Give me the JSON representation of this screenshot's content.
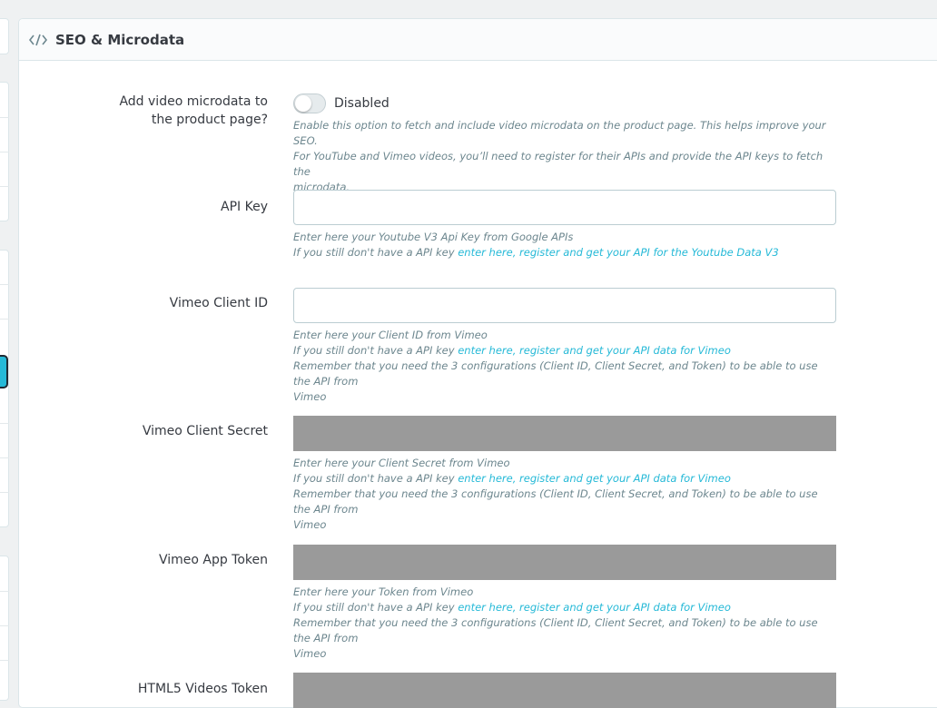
{
  "panel": {
    "title": "SEO & Microdata",
    "icon": "code-icon"
  },
  "microdata": {
    "label_line1": "Add video microdata to",
    "label_line2": "the product page?",
    "switch_state": "Disabled",
    "enabled": false,
    "help": [
      "Enable this option to fetch and include video microdata on the product page. This helps improve your SEO.",
      "For YouTube and Vimeo videos, you’ll need to register for their APIs and provide the API keys to fetch the",
      "microdata."
    ]
  },
  "api_key": {
    "label": "API Key",
    "value": "",
    "help1": "Enter here your Youtube V3 Api Key from Google APIs",
    "help2_prefix": "If you still don't have a API key",
    "help2_link": "enter here, register and get your API for the Youtube Data V3"
  },
  "vimeo_client_id": {
    "label": "Vimeo Client ID",
    "value": "",
    "help1": "Enter here your Client ID from Vimeo",
    "help2_prefix": "If you still don't have a API key",
    "help2_link": "enter here, register and get your API data for Vimeo",
    "help3": "Remember that you need the 3 configurations (Client ID, Client Secret, and Token) to be able to use the API from",
    "help4": "Vimeo"
  },
  "vimeo_client_secret": {
    "label": "Vimeo Client Secret",
    "help1": "Enter here your Client Secret from Vimeo",
    "help2_prefix": "If you still don't have a API key",
    "help2_link": "enter here, register and get your API data for Vimeo",
    "help3": "Remember that you need the 3 configurations (Client ID, Client Secret, and Token) to be able to use the API from",
    "help4": "Vimeo"
  },
  "vimeo_app_token": {
    "label": "Vimeo App Token",
    "help1": "Enter here your Token from Vimeo",
    "help2_prefix": "If you still don't have a API key",
    "help2_link": "enter here, register and get your API data for Vimeo",
    "help3": "Remember that you need the 3 configurations (Client ID, Client Secret, and Token) to be able to use the API from",
    "help4": "Vimeo"
  },
  "html5_videos_token": {
    "label": "HTML5 Videos Token"
  },
  "colors": {
    "accent": "#25b9d7",
    "disabled_field": "#9a9a9a"
  }
}
